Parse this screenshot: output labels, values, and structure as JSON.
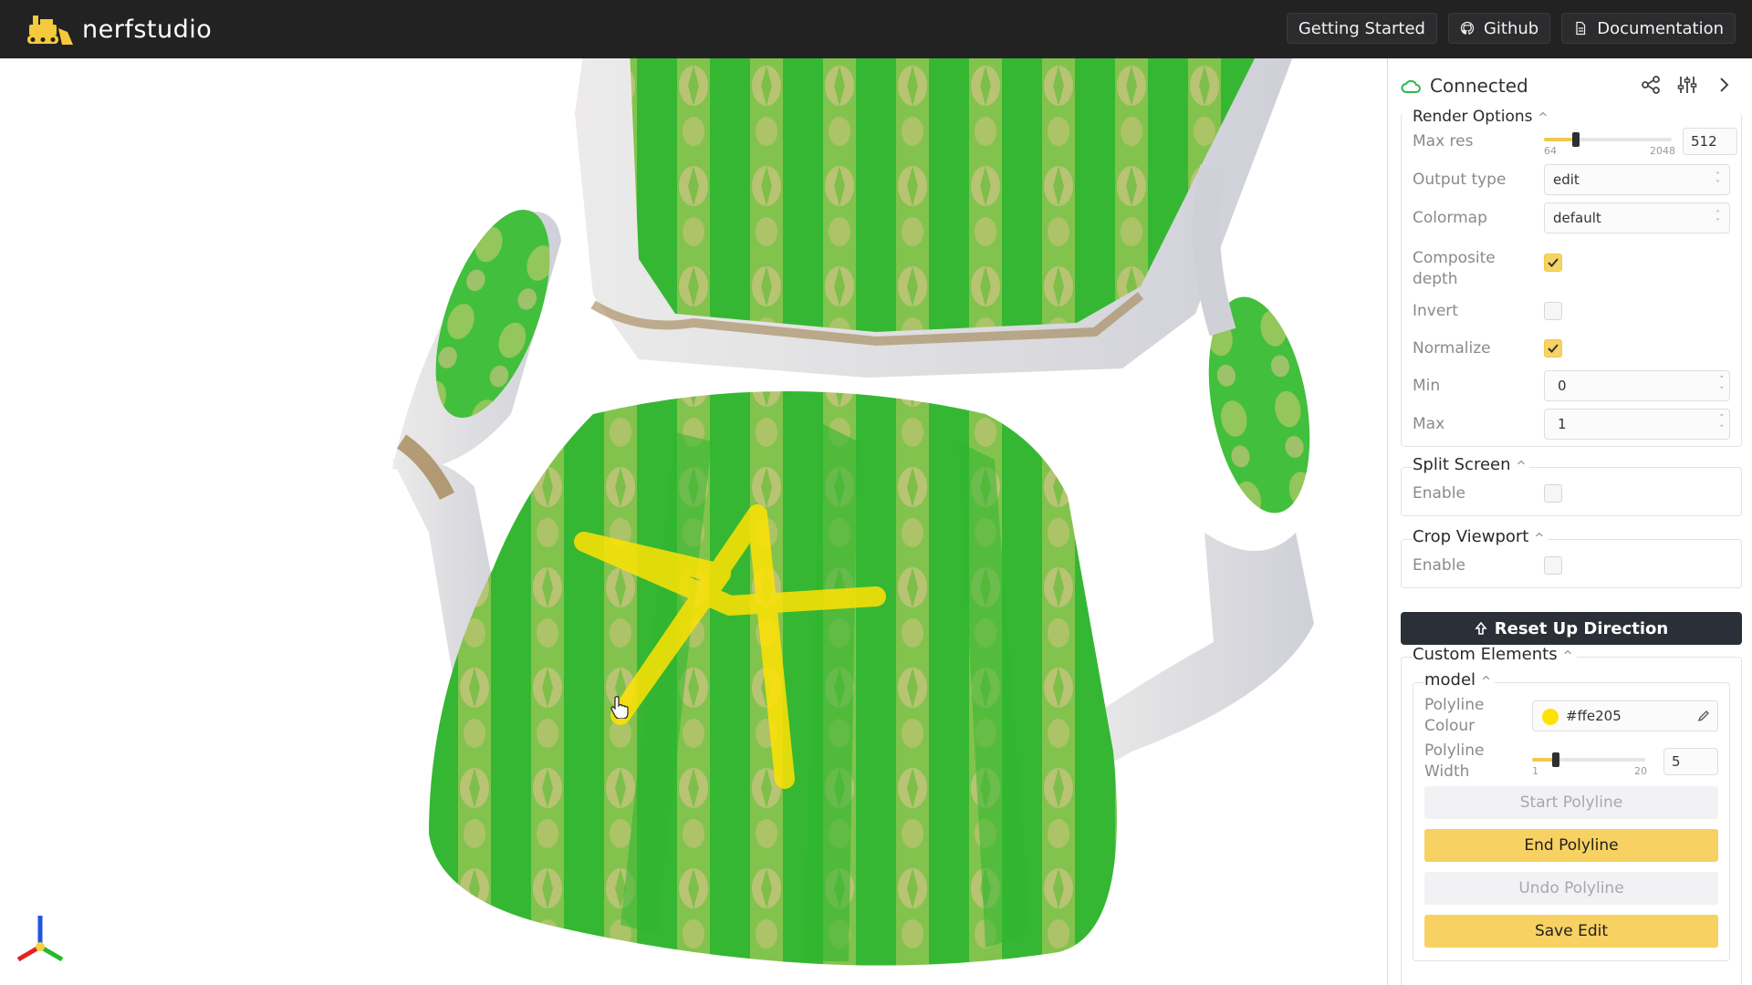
{
  "app": {
    "name": "nerfstudio"
  },
  "nav": {
    "getting_started": "Getting Started",
    "github": "Github",
    "documentation": "Documentation"
  },
  "panel": {
    "status": "Connected",
    "render_options": {
      "title": "Render Options",
      "max_res": {
        "label": "Max res",
        "min": "64",
        "max": "2048",
        "value": "512",
        "fraction": 0.22
      },
      "output_type": {
        "label": "Output type",
        "value": "edit"
      },
      "colormap": {
        "label": "Colormap",
        "value": "default"
      },
      "composite_depth": {
        "label": "Composite depth",
        "checked": true
      },
      "invert": {
        "label": "Invert",
        "checked": false
      },
      "normalize": {
        "label": "Normalize",
        "checked": true
      },
      "min": {
        "label": "Min",
        "value": "0"
      },
      "max": {
        "label": "Max",
        "value": "1"
      }
    },
    "split_screen": {
      "title": "Split Screen",
      "enable_label": "Enable",
      "checked": false
    },
    "crop_viewport": {
      "title": "Crop Viewport",
      "enable_label": "Enable",
      "checked": false
    },
    "reset_up": "Reset Up Direction",
    "custom_elements": {
      "title": "Custom Elements",
      "model": {
        "title": "model",
        "polyline_colour": {
          "label": "Polyline Colour",
          "value": "#ffe205"
        },
        "polyline_width": {
          "label": "Polyline Width",
          "min": "1",
          "max": "20",
          "value": "5",
          "fraction": 0.2
        },
        "start_polyline": "Start Polyline",
        "end_polyline": "End Polyline",
        "undo_polyline": "Undo Polyline",
        "save_edit": "Save Edit"
      }
    }
  },
  "colors": {
    "accent": "#f7d161",
    "topbar": "#222223",
    "polyline": "#ffe205",
    "fabric": "#3fbf3a"
  }
}
